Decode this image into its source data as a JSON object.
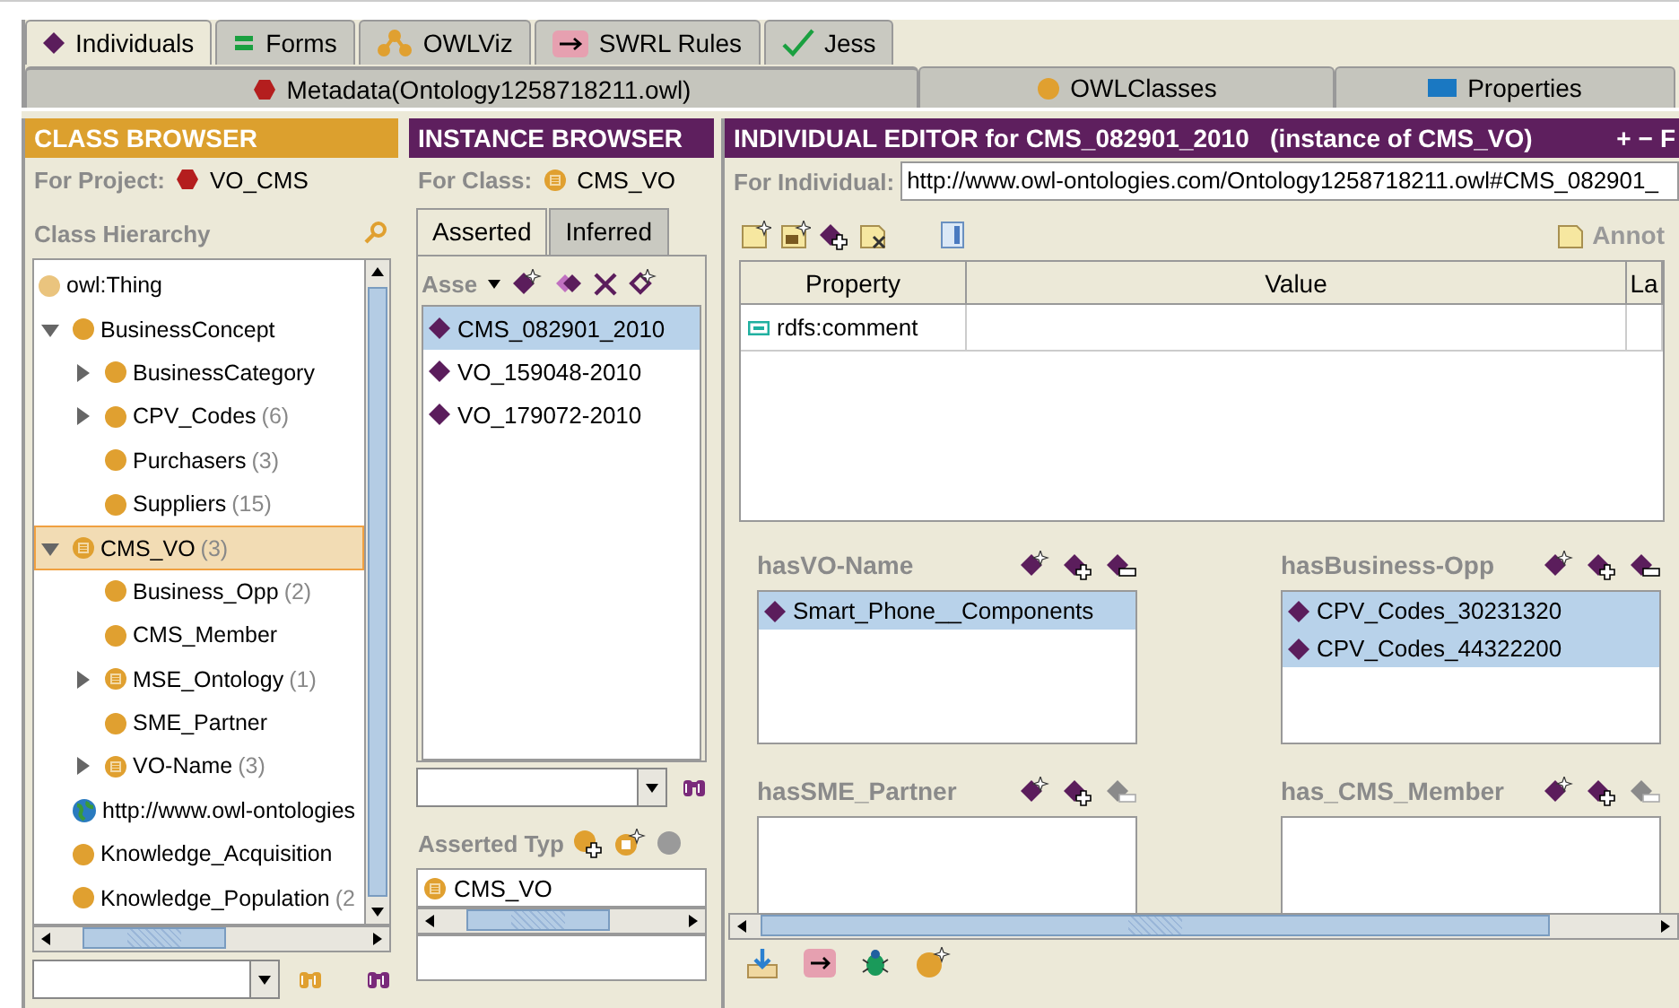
{
  "tabs": [
    {
      "label": "Individuals",
      "kind": "individuals",
      "selected": true
    },
    {
      "label": "Forms",
      "kind": "forms",
      "selected": false
    },
    {
      "label": "OWLViz",
      "kind": "owlviz",
      "selected": false
    },
    {
      "label": "SWRL Rules",
      "kind": "swrl",
      "selected": false
    },
    {
      "label": "Jess",
      "kind": "jess",
      "selected": false
    }
  ],
  "subtabs": [
    {
      "label": "Metadata(Ontology1258718211.owl)",
      "kind": "ontology",
      "selected": true
    },
    {
      "label": "OWLClasses",
      "kind": "classes",
      "selected": false
    },
    {
      "label": "Properties",
      "kind": "properties",
      "selected": false
    }
  ],
  "class_browser": {
    "title": "CLASS BROWSER",
    "project_label": "For Project:",
    "project": "VO_CMS",
    "hierarchy_label": "Class Hierarchy",
    "tree": [
      {
        "label": "owl:Thing",
        "kind": "thing",
        "selected": false,
        "children": [
          {
            "label": "BusinessConcept",
            "kind": "class",
            "selected": false,
            "expanded": true,
            "children": [
              {
                "label": "BusinessCategory",
                "kind": "class",
                "selected": false,
                "expanded": false
              },
              {
                "label": "CPV_Codes",
                "count": "(6)",
                "kind": "class",
                "selected": false,
                "expanded": false
              },
              {
                "label": "Purchasers",
                "count": "(3)",
                "kind": "class",
                "selected": false
              },
              {
                "label": "Suppliers",
                "count": "(15)",
                "kind": "class",
                "selected": false
              }
            ]
          },
          {
            "label": "CMS_VO",
            "count": "(3)",
            "kind": "defined",
            "selected": true,
            "expanded": true,
            "children": [
              {
                "label": "Business_Opp",
                "count": "(2)",
                "kind": "class",
                "selected": false
              },
              {
                "label": "CMS_Member",
                "kind": "class",
                "selected": false
              },
              {
                "label": "MSE_Ontology",
                "count": "(1)",
                "kind": "defined",
                "selected": false,
                "expanded": false
              },
              {
                "label": "SME_Partner",
                "kind": "class",
                "selected": false
              },
              {
                "label": "VO-Name",
                "count": "(3)",
                "kind": "defined",
                "selected": false,
                "expanded": false
              }
            ]
          },
          {
            "label": "http://www.owl-ontologies",
            "kind": "namespace",
            "selected": false
          },
          {
            "label": "Knowledge_Acquisition",
            "kind": "class",
            "selected": false
          },
          {
            "label": "Knowledge_Population",
            "count": "(2",
            "kind": "class",
            "selected": false
          }
        ]
      }
    ]
  },
  "instance_browser": {
    "title": "INSTANCE BROWSER",
    "class_label": "For Class:",
    "class_name": "CMS_VO",
    "tabs": [
      {
        "label": "Asserted",
        "selected": true
      },
      {
        "label": "Inferred",
        "selected": false
      }
    ],
    "filter": "Asse",
    "instances": [
      {
        "label": "CMS_082901_2010",
        "selected": true
      },
      {
        "label": "VO_159048-2010",
        "selected": false
      },
      {
        "label": "VO_179072-2010",
        "selected": false
      }
    ],
    "types_label": "Asserted Typ",
    "types": [
      {
        "label": "CMS_VO",
        "kind": "defined"
      }
    ]
  },
  "individual_editor": {
    "title": "INDIVIDUAL EDITOR for CMS_082901_2010   (instance of CMS_VO)",
    "title_buttons": [
      "+",
      "−",
      "F"
    ],
    "individual_label": "For Individual:",
    "individual_uri": "http://www.owl-ontologies.com/Ontology1258718211.owl#CMS_082901_",
    "annotations_button": "Annot",
    "table": {
      "columns": [
        "Property",
        "Value",
        "La"
      ],
      "rows": [
        {
          "property": "rdfs:comment"
        }
      ]
    },
    "properties": [
      {
        "name": "hasVO-Name",
        "remove_disabled": false,
        "values": [
          {
            "label": "Smart_Phone__Components",
            "selected": true
          }
        ]
      },
      {
        "name": "hasBusiness-Opp",
        "remove_disabled": false,
        "values": [
          {
            "label": "CPV_Codes_30231320",
            "selected": true
          },
          {
            "label": "CPV_Codes_44322200",
            "selected": true
          }
        ]
      },
      {
        "name": "hasSME_Partner",
        "remove_disabled": true
      },
      {
        "name": "has_CMS_Member",
        "remove_disabled": true
      }
    ]
  }
}
